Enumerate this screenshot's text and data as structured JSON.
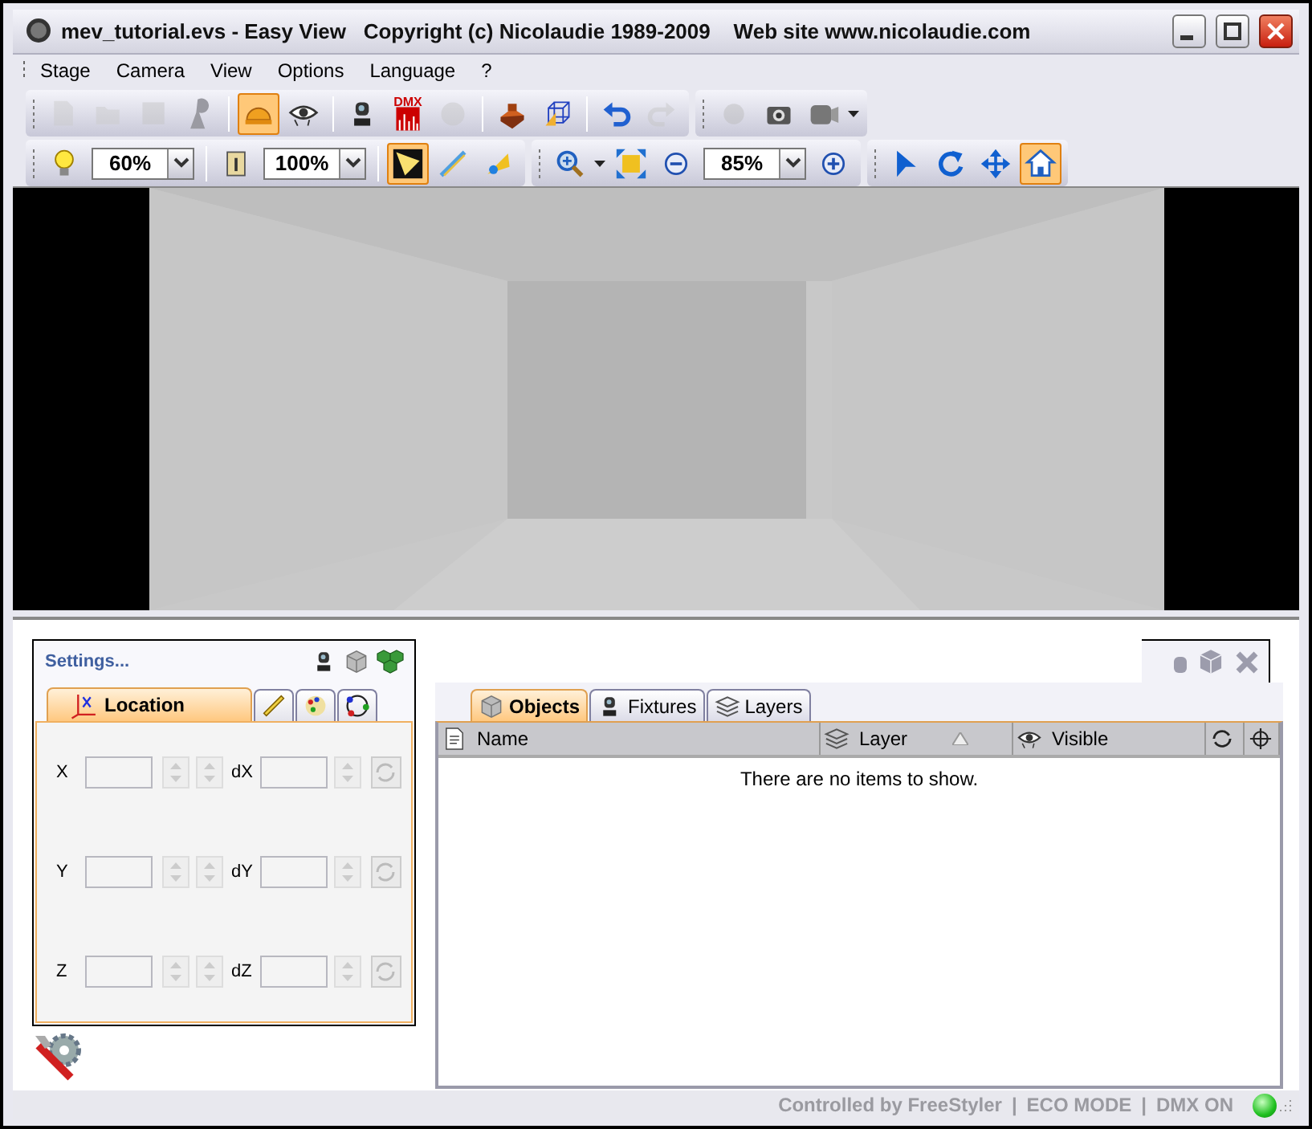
{
  "window": {
    "title": "mev_tutorial.evs - Easy View   Copyright (c) Nicolaudie 1989-2009    Web site www.nicolaudie.com"
  },
  "menu": [
    "Stage",
    "Camera",
    "View",
    "Options",
    "Language",
    "?"
  ],
  "toolbars": [
    {
      "groups": [
        {
          "items": [
            {
              "kind": "button",
              "selected": false,
              "disabled": true
            },
            {
              "kind": "button",
              "selected": false,
              "disabled": true
            },
            {
              "kind": "button",
              "selected": false,
              "disabled": true
            },
            {
              "kind": "button",
              "selected": false,
              "disabled": false
            },
            {
              "kind": "separator"
            },
            {
              "kind": "button",
              "selected": true,
              "disabled": false
            },
            {
              "kind": "button",
              "selected": false,
              "disabled": false
            },
            {
              "kind": "separator"
            },
            {
              "kind": "button",
              "selected": false,
              "disabled": false
            },
            {
              "kind": "button",
              "label": "DMX",
              "selected": false,
              "disabled": false
            },
            {
              "kind": "button",
              "selected": false,
              "disabled": true
            },
            {
              "kind": "separator"
            },
            {
              "kind": "button",
              "selected": false,
              "disabled": false
            },
            {
              "kind": "button",
              "selected": false,
              "disabled": false
            },
            {
              "kind": "separator"
            },
            {
              "kind": "button",
              "selected": false,
              "disabled": false
            },
            {
              "kind": "button",
              "selected": false,
              "disabled": true
            }
          ]
        },
        {
          "items": [
            {
              "kind": "button",
              "selected": false,
              "disabled": true
            },
            {
              "kind": "button",
              "selected": false,
              "disabled": false
            },
            {
              "kind": "button",
              "selected": false,
              "disabled": false
            },
            {
              "kind": "caret"
            }
          ]
        }
      ]
    },
    {
      "groups": [
        {
          "items": [
            {
              "kind": "button",
              "selected": false,
              "disabled": false
            },
            {
              "kind": "combo",
              "value": "60%"
            },
            {
              "kind": "separator"
            },
            {
              "kind": "button",
              "selected": false,
              "disabled": false
            },
            {
              "kind": "combo",
              "value": "100%"
            },
            {
              "kind": "separator"
            },
            {
              "kind": "button",
              "selected": true,
              "disabled": false
            },
            {
              "kind": "button",
              "selected": false,
              "disabled": false
            },
            {
              "kind": "button",
              "selected": false,
              "disabled": false
            }
          ]
        },
        {
          "items": [
            {
              "kind": "button",
              "selected": false,
              "disabled": false
            },
            {
              "kind": "caret"
            },
            {
              "kind": "button",
              "selected": false,
              "disabled": false
            },
            {
              "kind": "button",
              "selected": false,
              "disabled": false
            },
            {
              "kind": "combo",
              "value": "85%"
            },
            {
              "kind": "button",
              "selected": false,
              "disabled": false
            }
          ]
        },
        {
          "items": [
            {
              "kind": "button",
              "selected": false,
              "disabled": false
            },
            {
              "kind": "button",
              "selected": false,
              "disabled": false
            },
            {
              "kind": "button",
              "selected": false,
              "disabled": false
            },
            {
              "kind": "button",
              "selected": true,
              "disabled": false
            }
          ]
        }
      ]
    }
  ],
  "settings": {
    "title": "Settings...",
    "tabs": [
      {
        "label": "Location",
        "selected": true
      },
      {
        "selected": false
      },
      {
        "selected": false
      },
      {
        "selected": false
      }
    ],
    "rows": [
      {
        "label": "X",
        "delta_label": "dX",
        "disabled": true
      },
      {
        "label": "Y",
        "delta_label": "dY",
        "disabled": true
      },
      {
        "label": "Z",
        "delta_label": "dZ",
        "disabled": true
      }
    ]
  },
  "objects": {
    "tabs": [
      {
        "label": "Objects",
        "selected": true
      },
      {
        "label": "Fixtures",
        "selected": false
      },
      {
        "label": "Layers",
        "selected": false
      }
    ],
    "columns": [
      {
        "label": "Name",
        "sorted": false
      },
      {
        "label": "Layer",
        "sorted": true
      },
      {
        "label": "Visible",
        "sorted": false
      },
      {},
      {}
    ],
    "empty_message": "There are no items to show."
  },
  "status_bar": {
    "items": [
      "Controlled by FreeStyler",
      "|",
      "ECO MODE",
      "|",
      "DMX ON"
    ],
    "led_on": true
  }
}
